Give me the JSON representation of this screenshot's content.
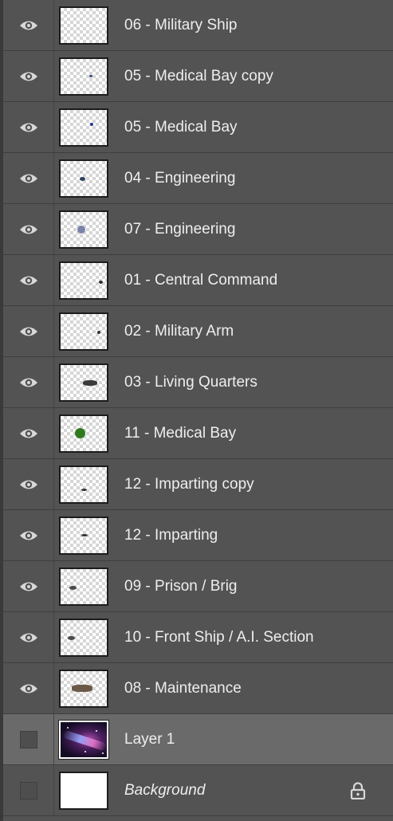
{
  "layers": [
    {
      "name": "06 - Military Ship",
      "visible": true,
      "thumb": "transparent"
    },
    {
      "name": "05 - Medical Bay copy",
      "visible": true,
      "thumb": "transparent"
    },
    {
      "name": "05 - Medical Bay",
      "visible": true,
      "thumb": "transparent"
    },
    {
      "name": "04 - Engineering",
      "visible": true,
      "thumb": "transparent"
    },
    {
      "name": "07 - Engineering",
      "visible": true,
      "thumb": "transparent"
    },
    {
      "name": "01 - Central Command",
      "visible": true,
      "thumb": "transparent"
    },
    {
      "name": "02 - Military Arm",
      "visible": true,
      "thumb": "transparent"
    },
    {
      "name": "03 - Living Quarters",
      "visible": true,
      "thumb": "transparent"
    },
    {
      "name": "11 - Medical Bay",
      "visible": true,
      "thumb": "transparent"
    },
    {
      "name": "12 - Imparting copy",
      "visible": true,
      "thumb": "transparent"
    },
    {
      "name": "12 - Imparting",
      "visible": true,
      "thumb": "transparent"
    },
    {
      "name": "09 - Prison / Brig",
      "visible": true,
      "thumb": "transparent"
    },
    {
      "name": "10 - Front Ship / A.I. Section",
      "visible": true,
      "thumb": "transparent"
    },
    {
      "name": "08 - Maintenance",
      "visible": true,
      "thumb": "transparent"
    },
    {
      "name": "Layer 1",
      "visible": false,
      "selected": true,
      "thumb": "space-image"
    },
    {
      "name": "Background",
      "visible": false,
      "locked": true,
      "thumb": "white-fill"
    }
  ],
  "icons": {
    "visibility": "eye-icon",
    "lock": "lock-icon"
  },
  "colors": {
    "panel_bg": "#535353",
    "selected_row_bg": "#6a6a6a",
    "text": "#eeeeee"
  }
}
